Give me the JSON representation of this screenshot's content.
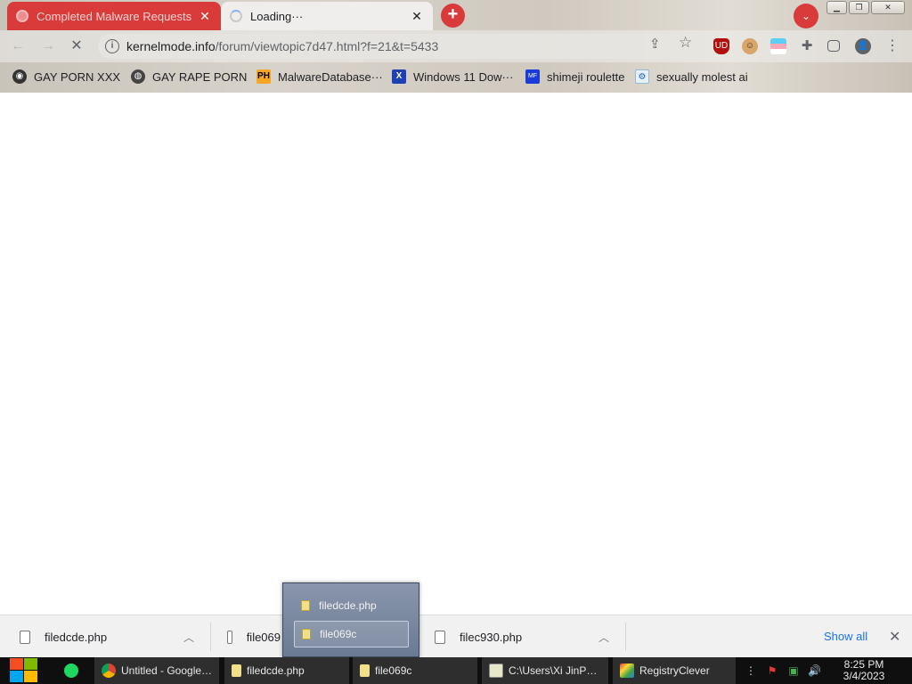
{
  "tabs": [
    {
      "title": "Completed Malware Requests",
      "close": "✕"
    },
    {
      "title": "Loading···",
      "close": "✕"
    }
  ],
  "new_tab_label": "+",
  "tab_search_label": "⌄",
  "window_controls": {
    "minimize": "▁",
    "restore": "❐",
    "close": "✕"
  },
  "nav": {
    "back": "←",
    "forward": "→",
    "reload": "✕"
  },
  "omnibox": {
    "host": "kernelmode.info",
    "path": "/forum/viewtopic7d47.html?f=21&t=5433"
  },
  "toolbar_icons": {
    "share": "⇪",
    "star": "☆",
    "menu": "⋮"
  },
  "extensions": [
    {
      "name": "ublock-icon",
      "label": "UD",
      "color": "#b30f0f"
    },
    {
      "name": "avatar-extension-icon",
      "label": "●",
      "color": "#6b3d1f"
    },
    {
      "name": "flag-extension-icon",
      "label": "≡",
      "color": "#5bcefa"
    },
    {
      "name": "puzzle-icon",
      "label": "✚",
      "color": "#5f6368"
    },
    {
      "name": "side-panel-icon",
      "label": "▮",
      "color": "#5f6368"
    },
    {
      "name": "profile-icon",
      "label": "●",
      "color": "#5f6368"
    }
  ],
  "bookmarks": [
    {
      "label": "GAY PORN XXX",
      "icon": "github-icon"
    },
    {
      "label": "GAY RAPE PORN",
      "icon": "globe-icon"
    },
    {
      "label": "MalwareDatabase···",
      "icon": "ph-icon",
      "badge": "PH"
    },
    {
      "label": "Windows 11 Dow···",
      "icon": "x-icon",
      "badge": "X"
    },
    {
      "label": "shimeji roulette",
      "icon": "mf-icon",
      "badge": "MF"
    },
    {
      "label": "sexually molest ai",
      "icon": "bot-icon",
      "badge": "⚙"
    }
  ],
  "downloads": [
    {
      "name": "filedcde.php"
    },
    {
      "name": "file069"
    },
    {
      "name": "filec930.php"
    }
  ],
  "download_bar": {
    "show_all": "Show all",
    "close": "✕",
    "chevron": "︿"
  },
  "popup": {
    "items": [
      "filedcde.php",
      "file069c"
    ]
  },
  "taskbar": {
    "apps": [
      {
        "label": "Untitled - Google…",
        "icon": "chrome-icon"
      },
      {
        "label": "filedcde.php",
        "icon": "file-icon"
      },
      {
        "label": "file069c",
        "icon": "file-icon"
      },
      {
        "label": "C:\\Users\\Xi JinP…",
        "icon": "notepad-icon"
      },
      {
        "label": "RegistryClever",
        "icon": "registry-icon"
      }
    ],
    "time": "8:25 PM",
    "date": "3/4/2023"
  }
}
